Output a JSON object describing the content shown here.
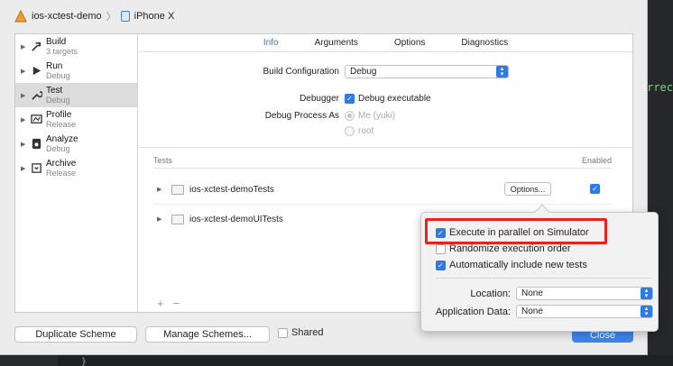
{
  "breadcrumb": {
    "project": "ios-xctest-demo",
    "device": "iPhone X"
  },
  "sidebar": {
    "items": [
      {
        "name": "Build",
        "sub": "3 targets",
        "icon": "hammer-icon"
      },
      {
        "name": "Run",
        "sub": "Debug",
        "icon": "play-icon"
      },
      {
        "name": "Test",
        "sub": "Debug",
        "icon": "wrench-icon"
      },
      {
        "name": "Profile",
        "sub": "Release",
        "icon": "gauge-icon"
      },
      {
        "name": "Analyze",
        "sub": "Debug",
        "icon": "analyze-icon"
      },
      {
        "name": "Archive",
        "sub": "Release",
        "icon": "archive-icon"
      }
    ],
    "selected": "Test"
  },
  "tabs": [
    "Info",
    "Arguments",
    "Options",
    "Diagnostics"
  ],
  "active_tab": "Info",
  "info": {
    "build_config_label": "Build Configuration",
    "build_config_value": "Debug",
    "debugger_label": "Debugger",
    "debugger_value": "Debug executable",
    "process_label": "Debug Process As",
    "process_me": "Me (yuki)",
    "process_root": "root"
  },
  "tests": {
    "header": "Tests",
    "enabled_header": "Enabled",
    "rows": [
      "ios-xctest-demoTests",
      "ios-xctest-demoUITests"
    ],
    "options_label": "Options..."
  },
  "popover": {
    "parallel": "Execute in parallel on Simulator",
    "randomize": "Randomize execution order",
    "auto_include": "Automatically include new tests",
    "location_label": "Location:",
    "location_value": "None",
    "appdata_label": "Application Data:",
    "appdata_value": "None"
  },
  "footer": {
    "duplicate": "Duplicate Scheme",
    "manage": "Manage Schemes...",
    "shared": "Shared",
    "close": "Close"
  },
  "editor": {
    "fragment": "orrec",
    "bottom_code": "}"
  },
  "colors": {
    "accent": "#2f7ae5",
    "highlight": "#e8221d"
  }
}
